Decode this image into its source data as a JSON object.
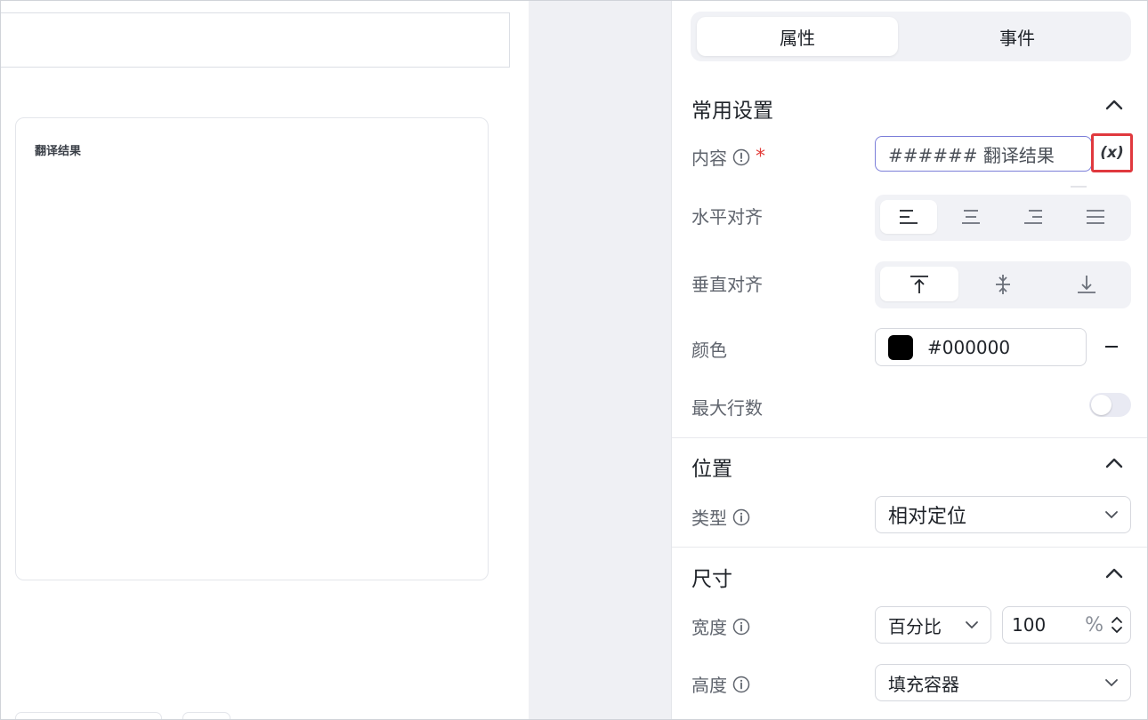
{
  "canvas": {
    "card_title": "翻译结果"
  },
  "tabs": [
    {
      "label": "属性"
    },
    {
      "label": "事件"
    }
  ],
  "sections": {
    "common": {
      "title": "常用设置",
      "content_label": "内容",
      "required_mark": "*",
      "content_value": "###### 翻译结果",
      "variable_button": "(x)",
      "h_align_label": "水平对齐",
      "h_align_options": [
        "align-left-icon",
        "align-center-icon",
        "align-right-icon",
        "align-justify-icon"
      ],
      "h_align_selected": "align-left",
      "v_align_label": "垂直对齐",
      "v_align_options": [
        "align-top-icon",
        "align-middle-icon",
        "align-bottom-icon"
      ],
      "v_align_selected": "align-top",
      "color_label": "颜色",
      "color_value": "#000000",
      "color_swatch": "#000000",
      "max_lines_label": "最大行数",
      "max_lines_enabled": false
    },
    "position": {
      "title": "位置",
      "type_label": "类型",
      "type_value": "相对定位"
    },
    "size": {
      "title": "尺寸",
      "width_label": "宽度",
      "width_unit_mode": "百分比",
      "width_value": "100",
      "width_unit": "%",
      "height_label": "高度",
      "height_value": "填充容器"
    }
  },
  "colors": {
    "accent_border": "#7b7ed9",
    "highlight": "#e0393e",
    "required": "#e23c39"
  }
}
